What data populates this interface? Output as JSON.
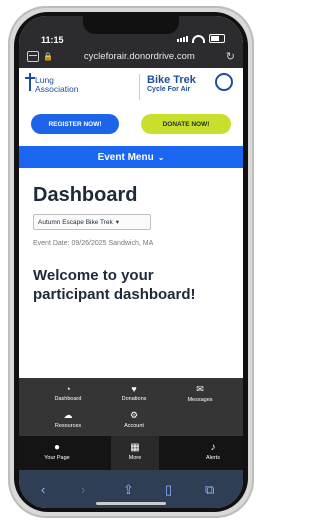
{
  "status": {
    "time": "11:15"
  },
  "browser": {
    "url": "cycleforair.donordrive.com"
  },
  "header": {
    "org_line1": "Lung",
    "org_line2": "Association",
    "event_title": "Bike Trek",
    "event_subtitle": "Cycle For Air"
  },
  "buttons": {
    "register": "REGISTER NOW!",
    "donate": "DONATE NOW!"
  },
  "menu": {
    "event_menu": "Event Menu"
  },
  "main": {
    "title": "Dashboard",
    "event_select": "Autumn Escape Bike Trek",
    "event_meta": "Event Date: 09/26/2025   Sandwich, MA",
    "welcome": "Welcome to your participant dashboard!"
  },
  "overlay_menu": {
    "items": [
      {
        "label": "Dashboard",
        "icon": "gauge-icon"
      },
      {
        "label": "Donations",
        "icon": "donations-icon"
      },
      {
        "label": "Messages",
        "icon": "envelope-icon"
      },
      {
        "label": "Resources",
        "icon": "cloud-icon"
      },
      {
        "label": "Account",
        "icon": "gear-icon"
      }
    ]
  },
  "bottom_nav": {
    "items": [
      {
        "label": "Your Page",
        "icon": "person-icon"
      },
      {
        "label": "More",
        "icon": "grid-icon"
      },
      {
        "label": "Alerts",
        "icon": "bell-icon"
      }
    ]
  },
  "colors": {
    "brand_blue": "#1a66f0",
    "register_blue": "#1d64e8",
    "donate_lime": "#c9df2b",
    "navy_text": "#1d2a3a"
  }
}
